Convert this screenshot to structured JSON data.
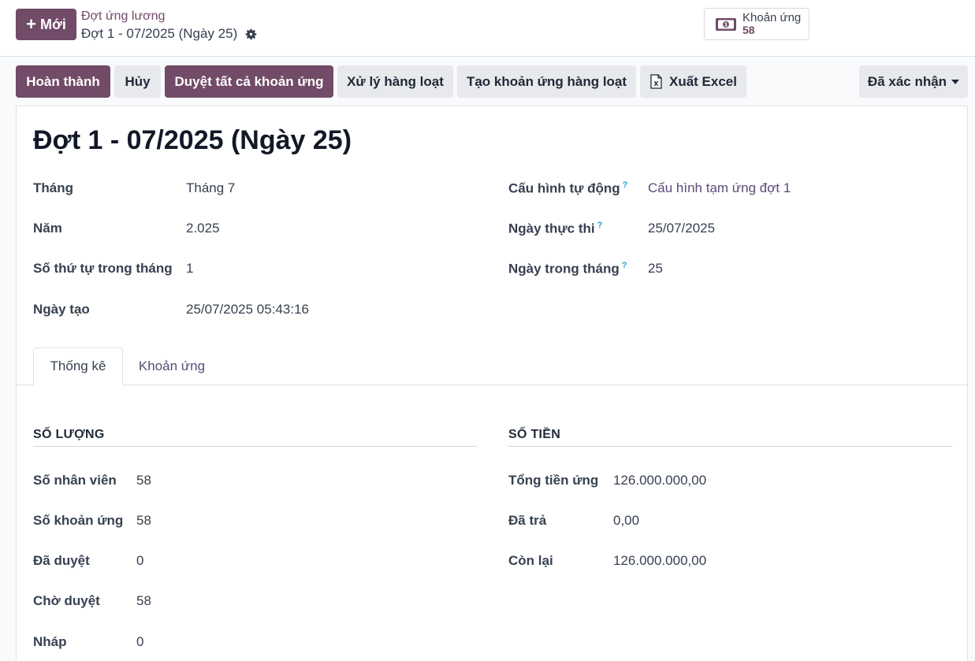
{
  "header": {
    "new_button": "Mới",
    "breadcrumb_parent": "Đợt ứng lương",
    "breadcrumb_current": "Đợt 1 - 07/2025 (Ngày 25)",
    "stat_label": "Khoản ứng",
    "stat_value": "58"
  },
  "actions": {
    "complete": "Hoàn thành",
    "cancel": "Hủy",
    "approve_all": "Duyệt tất cả khoản ứng",
    "batch_process": "Xử lý hàng loạt",
    "batch_create": "Tạo khoản ứng hàng loạt",
    "export_excel": "Xuất Excel",
    "status": "Đã xác nhận"
  },
  "form": {
    "title": "Đợt 1 - 07/2025 (Ngày 25)",
    "left": [
      {
        "label": "Tháng",
        "value": "Tháng 7"
      },
      {
        "label": "Năm",
        "value": "2.025"
      },
      {
        "label": "Số thứ tự trong tháng",
        "value": "1"
      },
      {
        "label": "Ngày tạo",
        "value": "25/07/2025 05:43:16"
      }
    ],
    "right": [
      {
        "label": "Cấu hình tự động",
        "value": "Cấu hình tạm ứng đợt 1"
      },
      {
        "label": "Ngày thực thi",
        "value": "25/07/2025"
      },
      {
        "label": "Ngày trong tháng",
        "value": "25"
      }
    ],
    "help_mark": "?"
  },
  "tabs": [
    "Thống kê",
    "Khoản ứng"
  ],
  "stats": {
    "quantity": {
      "title": "SỐ LƯỢNG",
      "rows": [
        {
          "label": "Số nhân viên",
          "value": "58"
        },
        {
          "label": "Số khoản ứng",
          "value": "58"
        },
        {
          "label": "Đã duyệt",
          "value": "0"
        },
        {
          "label": "Chờ duyệt",
          "value": "58"
        },
        {
          "label": "Nháp",
          "value": "0"
        }
      ]
    },
    "amount": {
      "title": "SỐ TIỀN",
      "rows": [
        {
          "label": "Tổng tiền ứng",
          "value": "126.000.000,00"
        },
        {
          "label": "Đã trả",
          "value": "0,00"
        },
        {
          "label": "Còn lại",
          "value": "126.000.000,00"
        }
      ]
    }
  },
  "colors": {
    "primary": "#714b67",
    "secondary_button": "#e7e9ed",
    "link": "#5a4a7a",
    "help": "#1fa4c9"
  }
}
